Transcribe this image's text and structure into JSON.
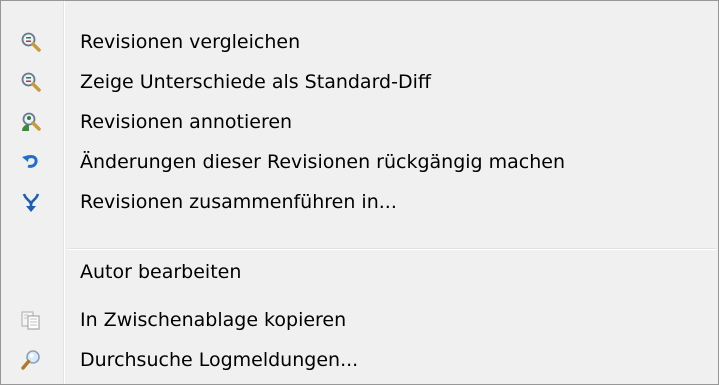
{
  "menu": {
    "items": [
      {
        "label": "Revisionen vergleichen",
        "icon": "magnifier-compare-icon"
      },
      {
        "label": "Zeige Unterschiede als Standard-Diff",
        "icon": "magnifier-diff-icon"
      },
      {
        "label": "Revisionen annotieren",
        "icon": "magnifier-person-blame-icon"
      },
      {
        "label": "Änderungen dieser Revisionen rückgängig machen",
        "icon": "undo-arrow-icon"
      },
      {
        "label": "Revisionen zusammenführen in...",
        "icon": "merge-arrow-icon"
      },
      {
        "label": "Autor bearbeiten",
        "icon": ""
      },
      {
        "label": "In Zwischenablage kopieren",
        "icon": "clipboard-copy-icon"
      },
      {
        "label": "Durchsuche Logmeldungen...",
        "icon": "search-magnifier-icon"
      }
    ]
  },
  "colors": {
    "menu_background": "#f0f0f0",
    "border": "#979797",
    "text": "#000000"
  }
}
